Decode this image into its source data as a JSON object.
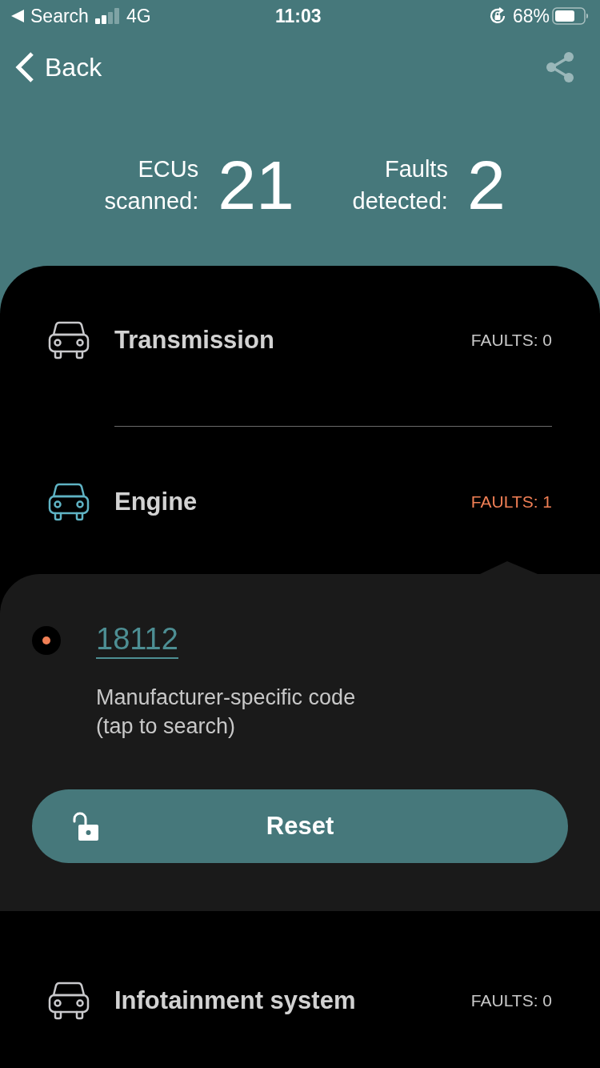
{
  "status_bar": {
    "back_label": "Search",
    "network": "4G",
    "time": "11:03",
    "battery": "68%"
  },
  "nav": {
    "back": "Back"
  },
  "summary": [
    {
      "label": "ECUs scanned:",
      "value": "21"
    },
    {
      "label": "Faults detected:",
      "value": "2"
    }
  ],
  "ecus": [
    {
      "name": "Transmission",
      "faults": "FAULTS: 0",
      "has_faults": false,
      "expanded": false
    },
    {
      "name": "Engine",
      "faults": "FAULTS: 1",
      "has_faults": true,
      "expanded": true,
      "codes": [
        {
          "code": "18112",
          "description": "Manufacturer-specific code (tap to search)",
          "color": "#f07f55"
        }
      ],
      "action": "Reset"
    },
    {
      "name": "Infotainment system",
      "faults": "FAULTS: 0",
      "has_faults": false,
      "expanded": false
    }
  ]
}
